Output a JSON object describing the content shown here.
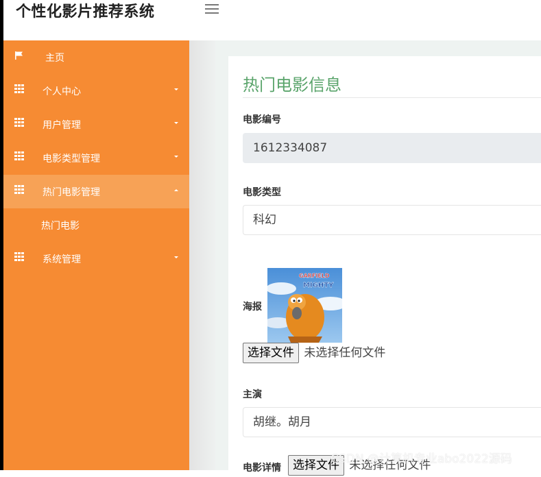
{
  "app": {
    "title": "个性化影片推荐系统"
  },
  "sidebar": {
    "items": [
      {
        "label": "主页",
        "icon": "flag-icon"
      },
      {
        "label": "个人中心",
        "icon": "grid-icon"
      },
      {
        "label": "用户管理",
        "icon": "grid-icon"
      },
      {
        "label": "电影类型管理",
        "icon": "grid-icon"
      },
      {
        "label": "热门电影管理",
        "icon": "grid-icon",
        "expanded": true
      },
      {
        "label": "系统管理",
        "icon": "grid-icon"
      }
    ],
    "subitems": [
      {
        "label": "热门电影"
      }
    ]
  },
  "form": {
    "title": "热门电影信息",
    "movie_id_label": "电影编号",
    "movie_id_value": "1612334087",
    "genre_label": "电影类型",
    "genre_value": "科幻",
    "poster_label": "海报",
    "poster_caption": "GARFIELD A-MIGHTY",
    "file_button": "选择文件",
    "file_none": "未选择任何文件",
    "cast_label": "主演",
    "cast_value": "胡继。胡月",
    "details_label": "电影详情",
    "details_file_button": "选择文件",
    "details_file_none": "未选择任何文件"
  },
  "watermark": "CSDN @计算机专业abo2022源码",
  "colors": {
    "sidebar": "#f68b33",
    "sidebar_active": "#f7a256",
    "title": "#5aa46b"
  }
}
